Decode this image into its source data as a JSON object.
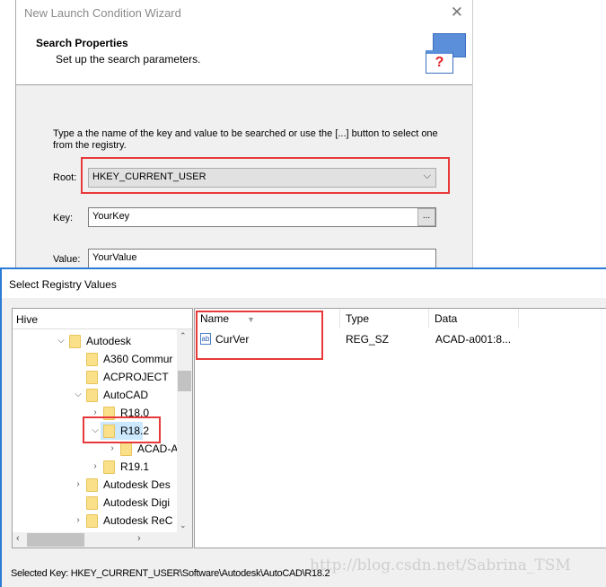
{
  "wizard": {
    "title": "New Launch Condition Wizard",
    "heading": "Search Properties",
    "subheading": "Set up the search parameters.",
    "instructions": "Type a the name of the key and value to be searched or use the [...] button to select one from the registry.",
    "root_label": "Root:",
    "root_value": "HKEY_CURRENT_USER",
    "key_label": "Key:",
    "key_value": "YourKey",
    "browse_label": "...",
    "value_label": "Value:",
    "value_value": "YourValue"
  },
  "registry": {
    "title": "Select Registry Values",
    "tree_header": "Hive",
    "tree": [
      {
        "label": "Autodesk",
        "level": 0,
        "expander": "expanded"
      },
      {
        "label": "A360 Commur",
        "level": 1,
        "expander": "none"
      },
      {
        "label": "ACPROJECT",
        "level": 1,
        "expander": "none"
      },
      {
        "label": "AutoCAD",
        "level": 1,
        "expander": "expanded"
      },
      {
        "label": "R18.0",
        "level": 2,
        "expander": "collapsed"
      },
      {
        "label": "R18.2",
        "level": 2,
        "expander": "expanded",
        "selected": true
      },
      {
        "label": "ACAD-A",
        "level": 3,
        "expander": "collapsed"
      },
      {
        "label": "R19.1",
        "level": 2,
        "expander": "collapsed"
      },
      {
        "label": "Autodesk Des",
        "level": 1,
        "expander": "collapsed"
      },
      {
        "label": "Autodesk Digi",
        "level": 1,
        "expander": "none"
      },
      {
        "label": "Autodesk ReC",
        "level": 1,
        "expander": "collapsed"
      }
    ],
    "columns": [
      "Name",
      "Type",
      "Data"
    ],
    "values": [
      {
        "name": "CurVer",
        "type": "REG_SZ",
        "data": "ACAD-a001:8..."
      }
    ],
    "status": "Selected Key: HKEY_CURRENT_USER\\Software\\Autodesk\\AutoCAD\\R18.2"
  },
  "watermark": "http://blog.csdn.net/Sabrina_TSM",
  "colors": {
    "highlight": "#e8393a",
    "selection": "#cce8ff",
    "accent": "#2b7bd6"
  }
}
